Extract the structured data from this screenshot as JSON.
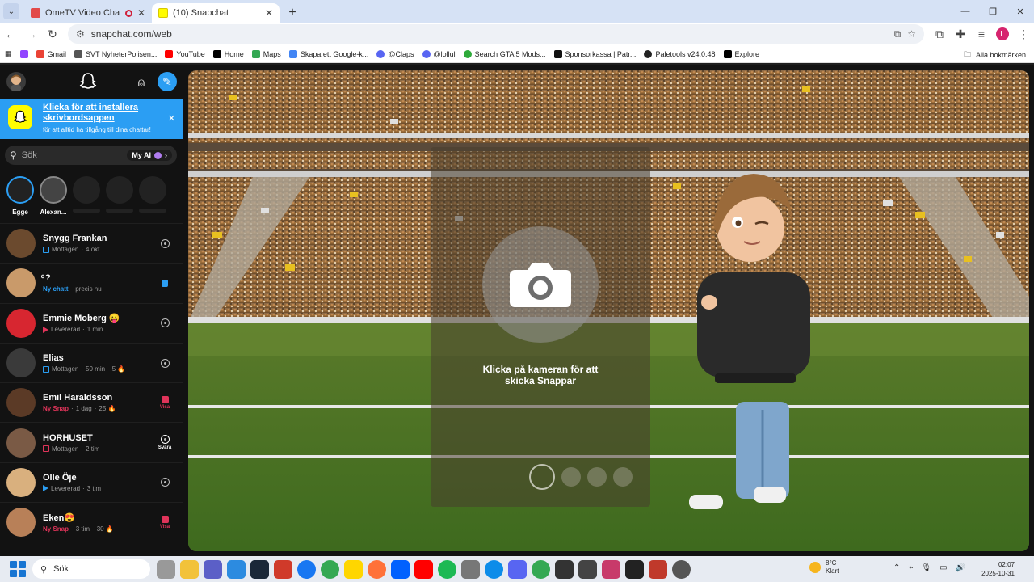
{
  "browser": {
    "tabs": [
      {
        "title": "OmeTV Video Chat — Ome",
        "active": false
      },
      {
        "title": "(10) Snapchat",
        "active": true
      }
    ],
    "url": "snapchat.com/web",
    "bookmarks": [
      "Gmail",
      "SVT NyheterPolisen...",
      "YouTube",
      "Home",
      "Maps",
      "Skapa ett Google-k...",
      "@Claps",
      "@lollul",
      "Search GTA 5 Mods...",
      "Sponsorkassa | Patr...",
      "Paletools v24.0.48",
      "Explore"
    ],
    "all_bookmarks": "Alla bokmärken",
    "profile_initial": "L"
  },
  "sidebar": {
    "banner_title": "Klicka för att installera skrivbordsappen",
    "banner_subtitle": "för att alltid ha tillgång till dina chattar!",
    "search_placeholder": "Sök",
    "my_ai": "My AI",
    "stories": [
      "Egge",
      "Alexan..."
    ],
    "chats": [
      {
        "name": "Snygg Frankan",
        "status": "Mottagen",
        "time": "4 okt.",
        "streak": "",
        "right": "camera",
        "right_label": ""
      },
      {
        "name": "ͦ ?",
        "status": "Ny chatt",
        "time": "precis nu",
        "streak": "",
        "right": "chat",
        "right_label": ""
      },
      {
        "name": "Emmie Moberg 😛",
        "status": "Levererad",
        "time": "1 min",
        "streak": "",
        "right": "camera",
        "right_label": ""
      },
      {
        "name": "Elias",
        "status": "Mottagen",
        "time": "50 min",
        "streak": "5 🔥",
        "right": "camera",
        "right_label": ""
      },
      {
        "name": "Emil Haraldsson",
        "status": "Ny Snap",
        "time": "1 dag",
        "streak": "25 🔥",
        "right": "snap",
        "right_label": "Visa"
      },
      {
        "name": "HORHUSET",
        "status": "Mottagen",
        "time": "2 tim",
        "streak": "",
        "right": "camera-white",
        "right_label": "Svara"
      },
      {
        "name": "Olle Öje",
        "status": "Levererad",
        "time": "3 tim",
        "streak": "",
        "right": "camera",
        "right_label": ""
      },
      {
        "name": "Eken😍",
        "status": "Ny Snap",
        "time": "3 tim",
        "streak": "30 🔥",
        "right": "snap",
        "right_label": "Visa"
      }
    ]
  },
  "camera": {
    "hint": "Klicka på kameran för att skicka Snappar"
  },
  "taskbar": {
    "search": "Sök",
    "temperature": "8°C",
    "weather": "Klart",
    "time": "02:07",
    "date": "2025-10-31"
  },
  "colors": {
    "snap_blue": "#2b9ef3",
    "snap_red": "#e0345a",
    "snap_yellow": "#fffc00"
  }
}
